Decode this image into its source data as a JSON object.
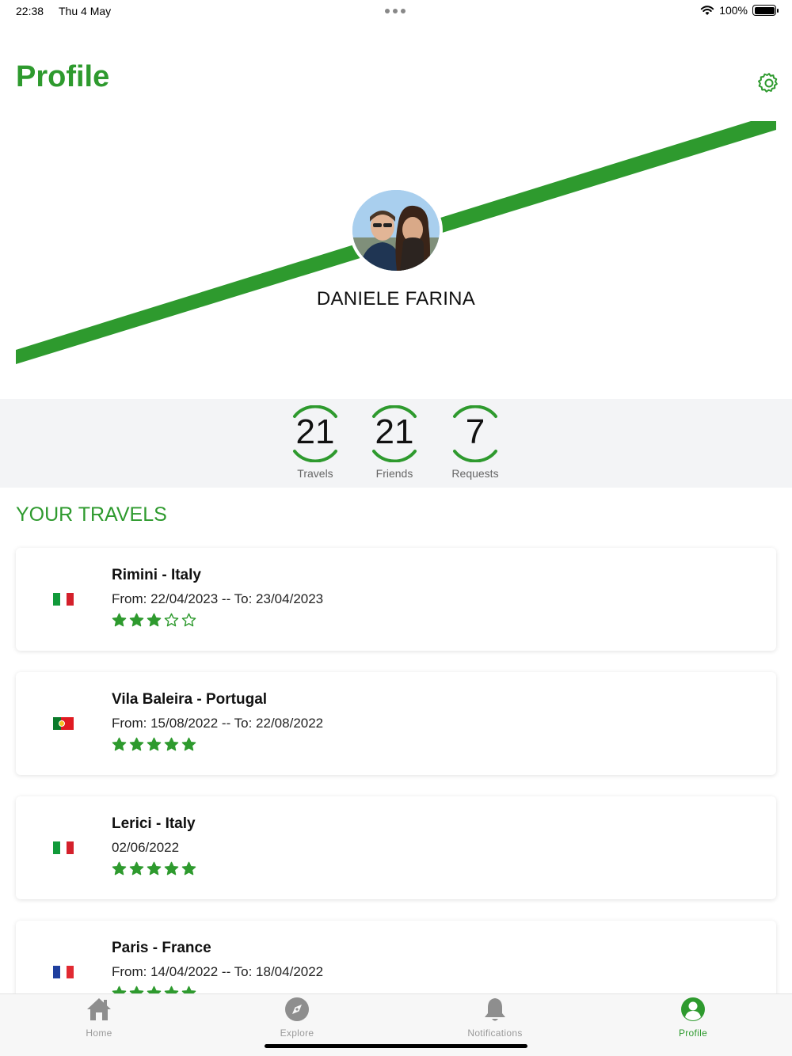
{
  "status_bar": {
    "time": "22:38",
    "date": "Thu 4 May",
    "battery": "100%"
  },
  "header": {
    "title": "Profile",
    "settings_icon": "gear-icon"
  },
  "profile": {
    "name": "DANIELE FARINA",
    "accent_color": "#2e9a2e"
  },
  "stats": [
    {
      "value": "21",
      "label": "Travels"
    },
    {
      "value": "21",
      "label": "Friends"
    },
    {
      "value": "7",
      "label": "Requests"
    }
  ],
  "section": {
    "title": "YOUR TRAVELS"
  },
  "travels": [
    {
      "place": "Rimini - Italy",
      "dates": "From: 22/04/2023 -- To: 23/04/2023",
      "rating": 3,
      "flag": "italy"
    },
    {
      "place": "Vila Baleira - Portugal",
      "dates": "From: 15/08/2022 -- To: 22/08/2022",
      "rating": 5,
      "flag": "portugal"
    },
    {
      "place": "Lerici - Italy",
      "dates": "02/06/2022",
      "rating": 5,
      "flag": "italy"
    },
    {
      "place": "Paris - France",
      "dates": "From: 14/04/2022 -- To: 18/04/2022",
      "rating": 5,
      "flag": "france"
    }
  ],
  "tabs": [
    {
      "label": "Home",
      "icon": "home-icon",
      "active": false
    },
    {
      "label": "Explore",
      "icon": "compass-icon",
      "active": false
    },
    {
      "label": "Notifications",
      "icon": "bell-icon",
      "active": false
    },
    {
      "label": "Profile",
      "icon": "person-icon",
      "active": true
    }
  ]
}
